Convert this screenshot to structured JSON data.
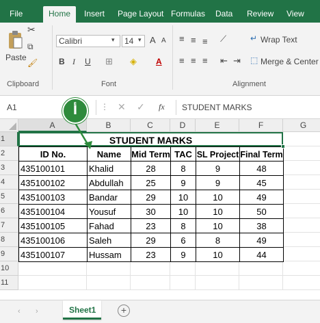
{
  "ribbon_tabs": [
    "File",
    "Home",
    "Insert",
    "Page Layout",
    "Formulas",
    "Data",
    "Review",
    "View"
  ],
  "clipboard": {
    "paste": "Paste",
    "group": "Clipboard"
  },
  "font": {
    "name": "Calibri",
    "size": "14",
    "bold": "B",
    "italic": "I",
    "underline": "U",
    "grow": "A",
    "shrink": "A",
    "color": "A",
    "group": "Font"
  },
  "alignment": {
    "wrap": "Wrap Text",
    "merge": "Merge & Center",
    "group": "Alignment"
  },
  "formula_bar": {
    "name_box": "A1",
    "fx": "fx",
    "content": "STUDENT MARKS"
  },
  "callout": {
    "label": "أ",
    "color": "#2e8b3c"
  },
  "columns": [
    "A",
    "B",
    "C",
    "D",
    "E",
    "F",
    "G"
  ],
  "rows": [
    "1",
    "2",
    "3",
    "4",
    "5",
    "6",
    "7",
    "8",
    "9",
    "10",
    "11"
  ],
  "table": {
    "title": "STUDENT MARKS",
    "headers": [
      "ID No.",
      "Name",
      "Mid Term",
      "TAC",
      "SL Project",
      "Final Term"
    ],
    "rows": [
      [
        "435100101",
        "Khalid",
        "28",
        "8",
        "9",
        "48"
      ],
      [
        "435100102",
        "Abdullah",
        "25",
        "9",
        "9",
        "45"
      ],
      [
        "435100103",
        "Bandar",
        "29",
        "10",
        "10",
        "49"
      ],
      [
        "435100104",
        "Yousuf",
        "30",
        "10",
        "10",
        "50"
      ],
      [
        "435100105",
        "Fahad",
        "23",
        "8",
        "10",
        "38"
      ],
      [
        "435100106",
        "Saleh",
        "29",
        "6",
        "8",
        "49"
      ],
      [
        "435100107",
        "Hussam",
        "23",
        "9",
        "10",
        "44"
      ]
    ]
  },
  "sheet_tabs": [
    "Sheet1"
  ],
  "colors": {
    "excel_green": "#217346",
    "ribbon_bg": "#f3f3f3"
  }
}
